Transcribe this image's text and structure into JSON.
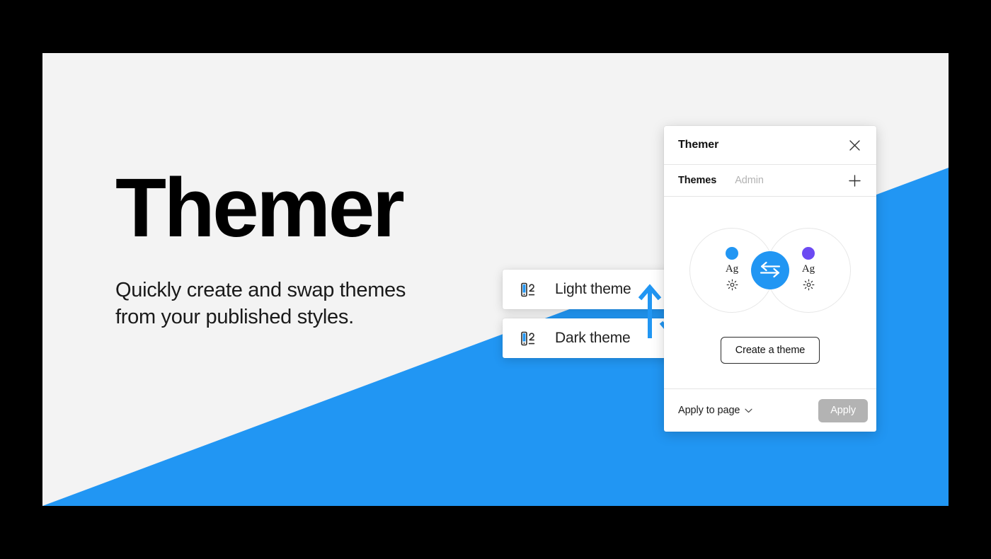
{
  "cover": {
    "headline": "Themer",
    "subhead": "Quickly create and swap themes\nfrom your published styles.",
    "background_color": "#F3F3F3",
    "accent_color": "#2196F3",
    "outer_color": "#000000"
  },
  "menu": {
    "items": [
      {
        "label": "Light theme",
        "icon": "style-swatch-icon"
      },
      {
        "label": "Dark theme",
        "icon": "style-swatch-icon"
      }
    ],
    "swap_arrows_icon": "swap-vertical-arrows-icon"
  },
  "panel": {
    "title": "Themer",
    "close_icon": "close-icon",
    "tabs": [
      {
        "label": "Themes",
        "active": true
      },
      {
        "label": "Admin",
        "active": false
      }
    ],
    "add_icon": "plus-icon",
    "venn": {
      "left": {
        "swatch_color": "#2196F3",
        "type_sample": "Ag",
        "effect_icon": "sun-effect-icon"
      },
      "right": {
        "swatch_color": "#6C4AF2",
        "type_sample": "Ag",
        "effect_icon": "sun-effect-icon"
      },
      "swap_button_icon": "swap-horizontal-arrows-icon",
      "swap_button_color": "#2196F3"
    },
    "create_button": "Create a theme",
    "footer": {
      "apply_scope_label": "Apply to page",
      "apply_scope_chevron": "chevron-down-icon",
      "apply_button": "Apply",
      "apply_button_color": "#B3B3B3"
    }
  }
}
